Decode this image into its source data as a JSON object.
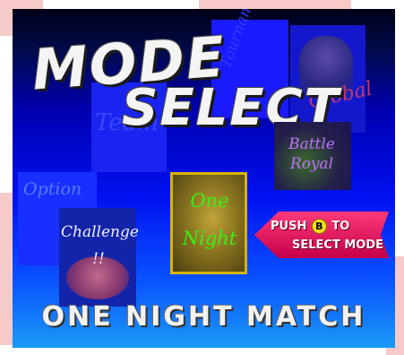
{
  "header": {
    "line1": "MODE",
    "line2": "SELECT"
  },
  "modes": [
    {
      "label": "Tournament",
      "selected": false
    },
    {
      "label": "Global",
      "selected": false
    },
    {
      "label": "Team",
      "selected": false
    },
    {
      "label": "Battle Royal",
      "selected": false
    },
    {
      "label": "Option",
      "selected": false
    },
    {
      "label": "Challenge !!",
      "selected": false
    },
    {
      "label": "One Night",
      "selected": true
    }
  ],
  "hint": {
    "push": "PUSH",
    "button": "B",
    "to": "TO",
    "line2": "SELECT MODE"
  },
  "footer": {
    "mode_name": "ONE NIGHT MATCH"
  }
}
